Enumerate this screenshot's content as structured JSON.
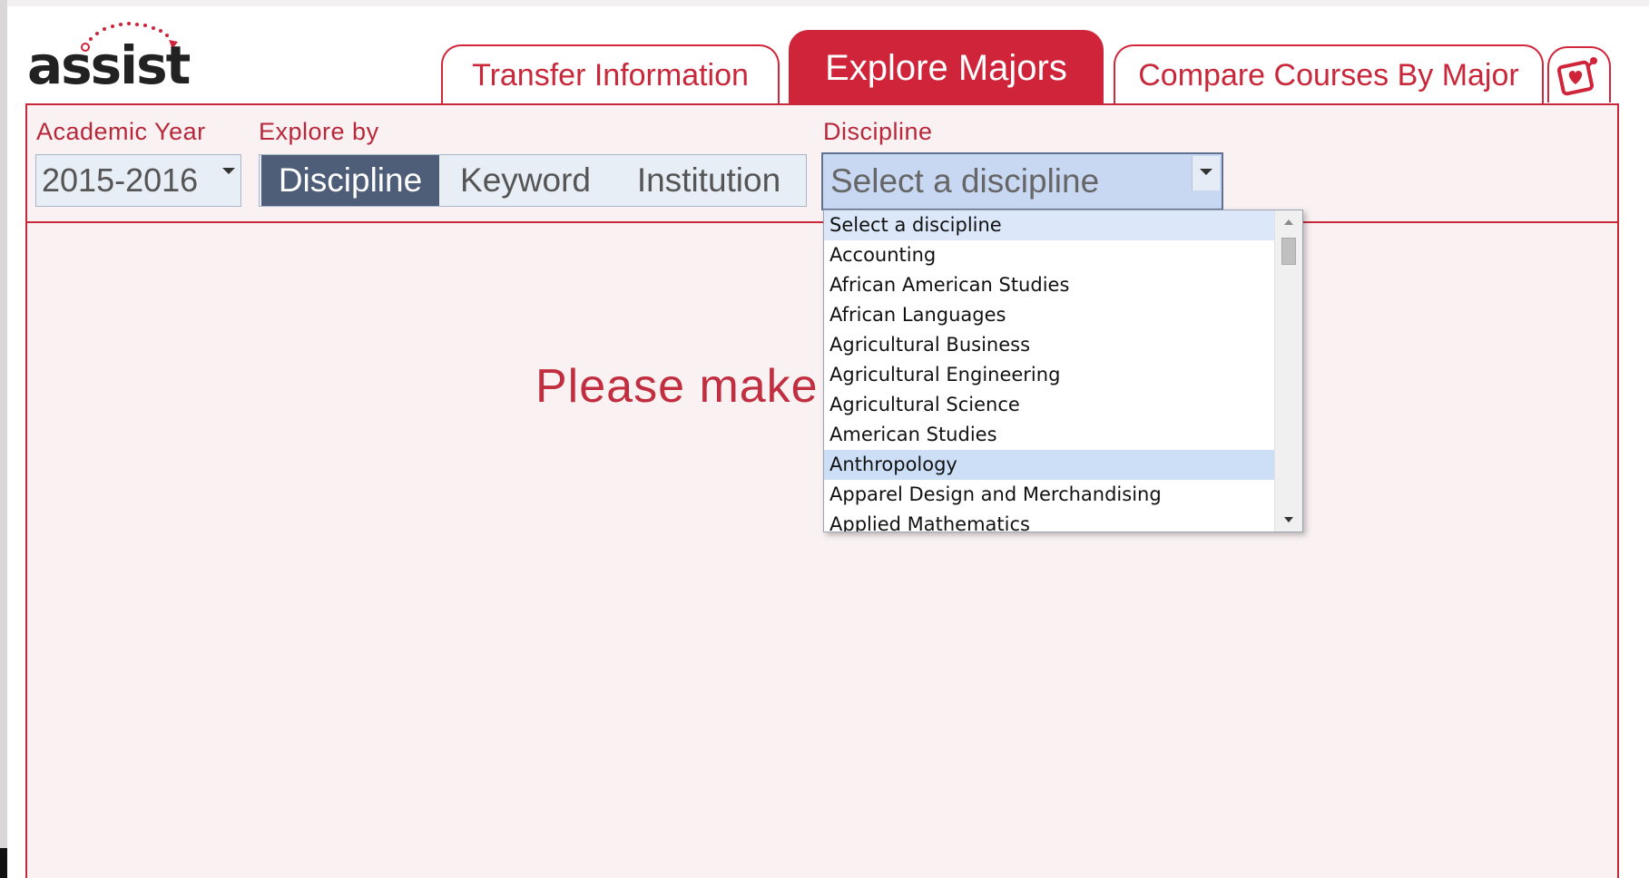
{
  "brand": {
    "logo_text": "assist",
    "accent": "#d0243a",
    "panel_bg": "#f9f1f2"
  },
  "tabs": [
    {
      "label": "Transfer Information",
      "active": false
    },
    {
      "label": "Explore Majors",
      "active": true
    },
    {
      "label": "Compare Courses By Major",
      "active": false
    }
  ],
  "favorites_icon": "heart-card-icon",
  "filters": {
    "academic_year_label": "Academic Year",
    "academic_year_value": "2015-2016",
    "explore_by_label": "Explore by",
    "explore_by_options": [
      "Discipline",
      "Keyword",
      "Institution"
    ],
    "explore_by_selected": "Discipline",
    "discipline_label": "Discipline",
    "discipline_value": "Select a discipline"
  },
  "message": "Please make",
  "dropdown": {
    "options": [
      "Select a discipline",
      "Accounting",
      "African American Studies",
      "African Languages",
      "Agricultural Business",
      "Agricultural Engineering",
      "Agricultural Science",
      "American Studies",
      "Anthropology",
      "Apparel Design and Merchandising",
      "Applied Mathematics"
    ],
    "selected_index": 0,
    "hover_index": 8
  }
}
